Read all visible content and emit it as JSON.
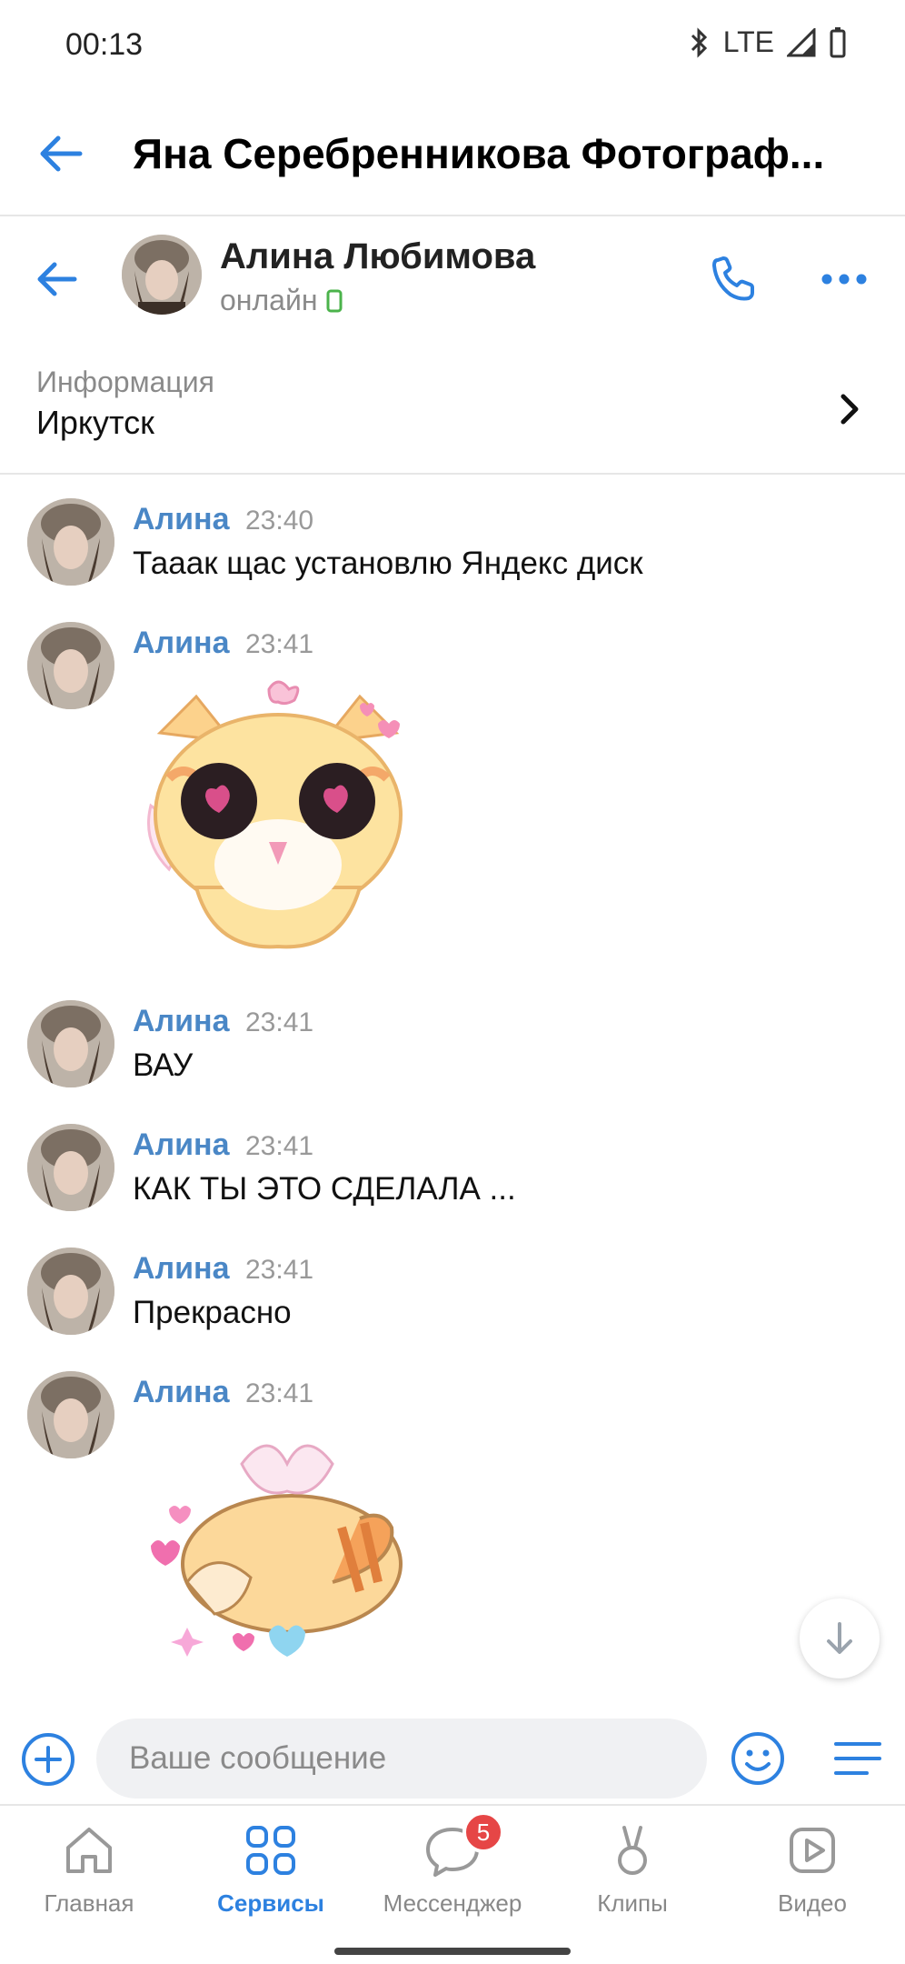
{
  "status_bar": {
    "time": "00:13",
    "network": "LTE"
  },
  "header": {
    "title": "Яна Серебренникова Фотограф..."
  },
  "chat": {
    "name": "Алина Любимова",
    "status": "онлайн"
  },
  "info": {
    "label": "Информация",
    "value": "Иркутск"
  },
  "messages": [
    {
      "author": "Алина",
      "time": "23:40",
      "text": "Тааак щас установлю Яндекс диск"
    },
    {
      "author": "Алина",
      "time": "23:41",
      "sticker": "sticker-cat-heart-eyes"
    },
    {
      "author": "Алина",
      "time": "23:41",
      "text": "ВАУ"
    },
    {
      "author": "Алина",
      "time": "23:41",
      "text": "КАК ТЫ ЭТО СДЕЛАЛА ..."
    },
    {
      "author": "Алина",
      "time": "23:41",
      "text": "Прекрасно"
    },
    {
      "author": "Алина",
      "time": "23:41",
      "sticker": "sticker-cat-lying-hearts"
    }
  ],
  "composer": {
    "placeholder": "Ваше сообщение"
  },
  "tabbar": {
    "tabs": [
      {
        "label": "Главная",
        "icon": "home-icon"
      },
      {
        "label": "Сервисы",
        "icon": "services-icon",
        "active": true
      },
      {
        "label": "Мессенджер",
        "icon": "messenger-icon",
        "badge": "5"
      },
      {
        "label": "Клипы",
        "icon": "clips-icon"
      },
      {
        "label": "Видео",
        "icon": "video-icon"
      }
    ]
  },
  "colors": {
    "accent": "#2d81e0",
    "author": "#4a87c6",
    "online": "#4bb34b",
    "badge": "#e64646"
  }
}
